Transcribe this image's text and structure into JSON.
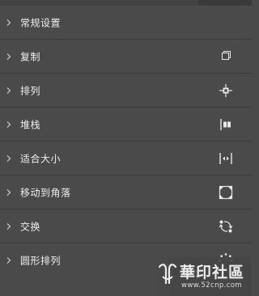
{
  "rows": [
    {
      "label": "常规设置",
      "icon": ""
    },
    {
      "label": "复制",
      "icon": "copy-icon"
    },
    {
      "label": "排列",
      "icon": "align-center-icon"
    },
    {
      "label": "堆栈",
      "icon": "stack-icon"
    },
    {
      "label": "适合大小",
      "icon": "fit-size-icon"
    },
    {
      "label": "移动到角落",
      "icon": "move-to-corner-icon"
    },
    {
      "label": "交换",
      "icon": "swap-icon"
    },
    {
      "label": "圆形排列",
      "icon": "circle-arrange-icon"
    }
  ],
  "watermark": {
    "text": "華印社區",
    "url": "www.52cnp.com"
  },
  "colors": {
    "background": "#4a4a4a",
    "divider": "#3b3b3b",
    "text": "#efefef",
    "icon": "#e8e8e8"
  }
}
